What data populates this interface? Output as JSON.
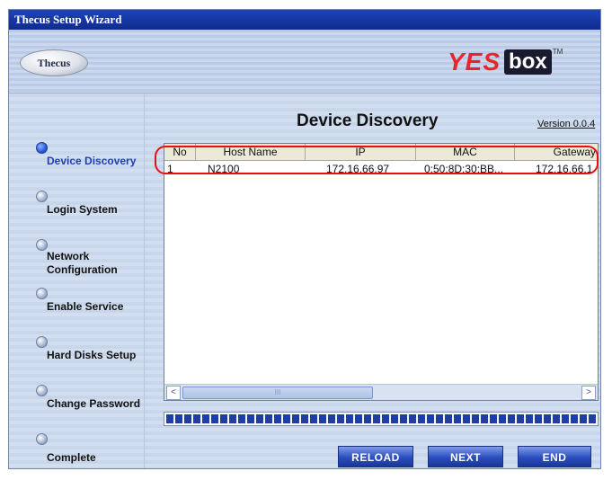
{
  "window": {
    "title": "Thecus Setup Wizard"
  },
  "banner": {
    "thecus_logo": "Thecus",
    "yes_logo": "YES",
    "box_logo": "box",
    "tm": "TM"
  },
  "steps": [
    {
      "label": "Device Discovery",
      "active": true
    },
    {
      "label": "Login System",
      "active": false
    },
    {
      "label": "Network Configuration",
      "active": false
    },
    {
      "label": "Enable Service",
      "active": false
    },
    {
      "label": "Hard Disks Setup",
      "active": false
    },
    {
      "label": "Change Password",
      "active": false
    },
    {
      "label": "Complete",
      "active": false
    }
  ],
  "main": {
    "title": "Device Discovery",
    "version": "Version 0.0.4"
  },
  "table": {
    "columns": [
      "No",
      "Host Name",
      "IP",
      "MAC",
      "Gateway"
    ],
    "rows": [
      {
        "no": "1",
        "host": "N2100",
        "ip": "172.16.66.97",
        "mac": "0:50:8D:30:BB...",
        "gateway": "172.16.66.1"
      }
    ]
  },
  "scrollbar": {
    "left_icon": "<",
    "right_icon": ">",
    "thumb_grip": "III"
  },
  "buttons": {
    "reload": "RELOAD",
    "next": "NEXT",
    "end": "END"
  },
  "colors": {
    "title_bar": "#1e44b8",
    "highlight": "#e60f0f",
    "button": "#2a4dbf"
  }
}
